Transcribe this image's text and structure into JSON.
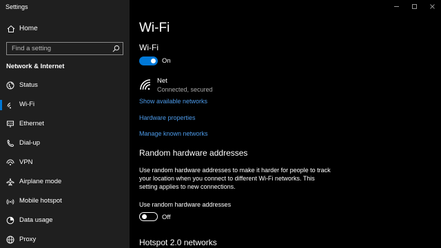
{
  "app": {
    "title": "Settings"
  },
  "sidebar": {
    "home_label": "Home",
    "search_placeholder": "Find a setting",
    "section_title": "Network & Internet",
    "items": [
      {
        "label": "Status",
        "icon": "globe-icon",
        "active": false
      },
      {
        "label": "Wi-Fi",
        "icon": "wifi-icon",
        "active": true
      },
      {
        "label": "Ethernet",
        "icon": "ethernet-icon",
        "active": false
      },
      {
        "label": "Dial-up",
        "icon": "phone-icon",
        "active": false
      },
      {
        "label": "VPN",
        "icon": "vpn-icon",
        "active": false
      },
      {
        "label": "Airplane mode",
        "icon": "airplane-icon",
        "active": false
      },
      {
        "label": "Mobile hotspot",
        "icon": "hotspot-icon",
        "active": false
      },
      {
        "label": "Data usage",
        "icon": "data-usage-icon",
        "active": false
      },
      {
        "label": "Proxy",
        "icon": "proxy-globe-icon",
        "active": false
      }
    ]
  },
  "main": {
    "page_title": "Wi-Fi",
    "wifi_section_title": "Wi-Fi",
    "wifi_toggle": {
      "state": "on",
      "label": "On"
    },
    "network": {
      "name": "Net",
      "status": "Connected, secured"
    },
    "links": {
      "show_networks": "Show available networks",
      "hardware_properties": "Hardware properties",
      "manage_networks": "Manage known networks"
    },
    "random_hw": {
      "heading": "Random hardware addresses",
      "description": "Use random hardware addresses to make it harder for people to track your location when you connect to different Wi-Fi networks. This setting applies to new connections.",
      "field_label": "Use random hardware addresses",
      "toggle": {
        "state": "off",
        "label": "Off"
      }
    },
    "hotspot_heading": "Hotspot 2.0 networks"
  },
  "colors": {
    "accent": "#0078d7",
    "link": "#4d9bea",
    "sidebar_bg": "#1f1f1f",
    "main_bg": "#000000"
  }
}
